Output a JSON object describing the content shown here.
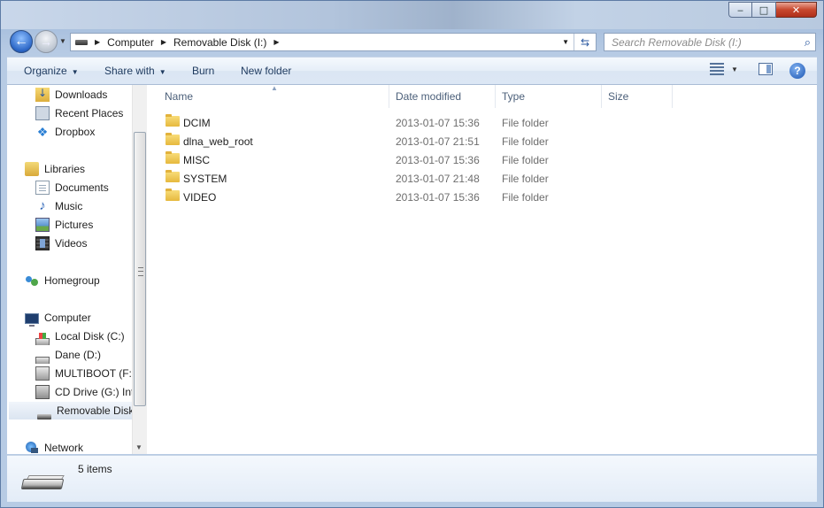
{
  "window": {
    "caption_minimize": "‒",
    "caption_maximize": "□",
    "caption_close": "✕"
  },
  "nav": {
    "breadcrumbs": [
      "Computer",
      "Removable Disk (I:)"
    ],
    "search_placeholder": "Search Removable Disk (I:)"
  },
  "toolbar": {
    "organize": "Organize",
    "share_with": "Share with",
    "burn": "Burn",
    "new_folder": "New folder"
  },
  "sidebar": {
    "items": [
      {
        "label": "Downloads",
        "icon": "downloads-icon"
      },
      {
        "label": "Recent Places",
        "icon": "recent-places-icon"
      },
      {
        "label": "Dropbox",
        "icon": "dropbox-icon"
      },
      {
        "label": "Libraries",
        "icon": "libraries-icon"
      },
      {
        "label": "Documents",
        "icon": "documents-icon"
      },
      {
        "label": "Music",
        "icon": "music-icon"
      },
      {
        "label": "Pictures",
        "icon": "pictures-icon"
      },
      {
        "label": "Videos",
        "icon": "videos-icon"
      },
      {
        "label": "Homegroup",
        "icon": "homegroup-icon"
      },
      {
        "label": "Computer",
        "icon": "computer-icon"
      },
      {
        "label": "Local Disk (C:)",
        "icon": "local-disk-icon"
      },
      {
        "label": "Dane (D:)",
        "icon": "disk-icon"
      },
      {
        "label": "MULTIBOOT (F:)",
        "icon": "usb-drive-icon"
      },
      {
        "label": "CD Drive (G:) Inte",
        "icon": "cd-drive-icon"
      },
      {
        "label": "Removable Disk (",
        "icon": "removable-disk-icon",
        "selected": true
      },
      {
        "label": "Network",
        "icon": "network-icon"
      }
    ]
  },
  "columns": {
    "name": "Name",
    "date_modified": "Date modified",
    "type": "Type",
    "size": "Size"
  },
  "files": [
    {
      "name": "DCIM",
      "date": "2013-01-07 15:36",
      "type": "File folder"
    },
    {
      "name": "dlna_web_root",
      "date": "2013-01-07 21:51",
      "type": "File folder"
    },
    {
      "name": "MISC",
      "date": "2013-01-07 15:36",
      "type": "File folder"
    },
    {
      "name": "SYSTEM",
      "date": "2013-01-07 21:48",
      "type": "File folder"
    },
    {
      "name": "VIDEO",
      "date": "2013-01-07 15:36",
      "type": "File folder"
    }
  ],
  "details": {
    "items_count": "5 items"
  },
  "colors": {
    "accent": "#1e3a5f",
    "selection": "#dbe5f1"
  }
}
